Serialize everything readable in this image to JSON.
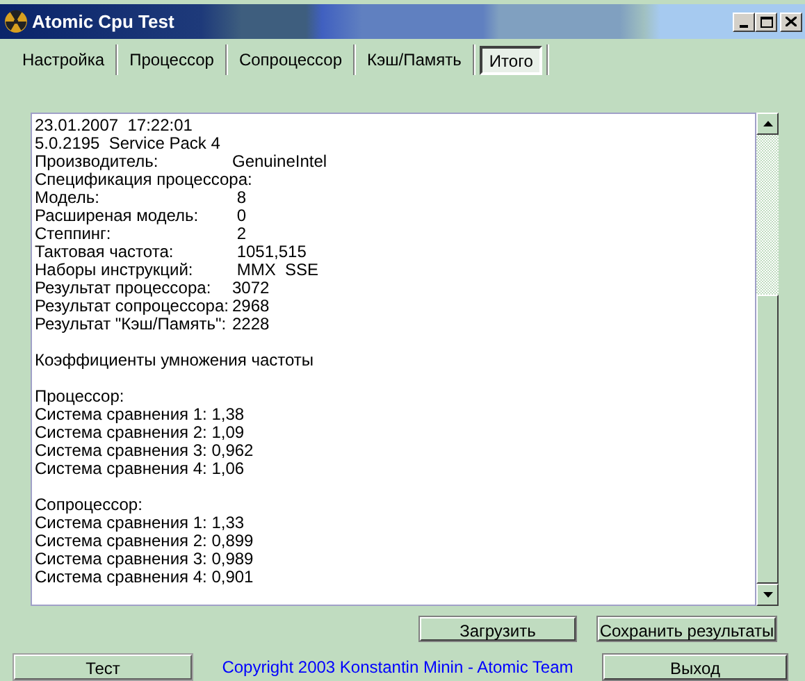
{
  "window": {
    "title": "Atomic Cpu Test"
  },
  "tabs": [
    {
      "label": "Настройка",
      "selected": false
    },
    {
      "label": "Процессор",
      "selected": false
    },
    {
      "label": "Сопроцессор",
      "selected": false
    },
    {
      "label": "Кэш/Память",
      "selected": false
    },
    {
      "label": "Итого",
      "selected": true
    }
  ],
  "report": [
    {
      "kind": "text",
      "text": "23.01.2007  17:22:01"
    },
    {
      "kind": "text",
      "text": "5.0.2195  Service Pack 4"
    },
    {
      "kind": "pair",
      "label": "Производитель:",
      "value": "GenuineIntel"
    },
    {
      "kind": "text",
      "text": "Спецификация процессора:"
    },
    {
      "kind": "pair",
      "label": "Модель:",
      "value": " 8"
    },
    {
      "kind": "pair",
      "label": "Расширеная модель:",
      "value": " 0"
    },
    {
      "kind": "pair",
      "label": "Степпинг:",
      "value": " 2"
    },
    {
      "kind": "pair",
      "label": "Тактовая частота:",
      "value": " 1051,515"
    },
    {
      "kind": "pair",
      "label": "Наборы инструкций:",
      "value": " MMX  SSE"
    },
    {
      "kind": "pair",
      "label": "Результат процессора:",
      "value": "3072"
    },
    {
      "kind": "pair",
      "label": "Результат сопроцессора:",
      "value": "2968"
    },
    {
      "kind": "pair",
      "label": "Результат \"Кэш/Память\":",
      "value": "2228"
    },
    {
      "kind": "gap"
    },
    {
      "kind": "text",
      "text": "Коэффициенты умножения частоты"
    },
    {
      "kind": "gap"
    },
    {
      "kind": "text",
      "text": "Процессор:"
    },
    {
      "kind": "text",
      "text": "Система сравнения 1: 1,38"
    },
    {
      "kind": "text",
      "text": "Система сравнения 2: 1,09"
    },
    {
      "kind": "text",
      "text": "Система сравнения 3: 0,962"
    },
    {
      "kind": "text",
      "text": "Система сравнения 4: 1,06"
    },
    {
      "kind": "gap"
    },
    {
      "kind": "text",
      "text": "Сопроцессор:"
    },
    {
      "kind": "text",
      "text": "Система сравнения 1: 1,33"
    },
    {
      "kind": "text",
      "text": "Система сравнения 2: 0,899"
    },
    {
      "kind": "text",
      "text": "Система сравнения 3: 0,989"
    },
    {
      "kind": "text",
      "text": "Система сравнения 4: 0,901"
    }
  ],
  "actions": [
    "Загрузить",
    "Сохранить результаты"
  ],
  "footer": {
    "test_button": "Тест",
    "copyright": "Copyright 2003 Konstantin Minin - Atomic Team",
    "exit_button": "Выход"
  }
}
